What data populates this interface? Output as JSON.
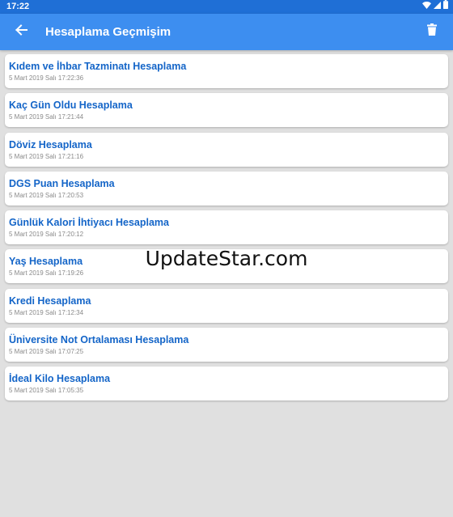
{
  "statusbar": {
    "time": "17:22",
    "icons": [
      "wifi-icon",
      "signal-icon",
      "battery-icon"
    ]
  },
  "appbar": {
    "title": "Hesaplama Geçmişim",
    "back_icon": "arrow-left-icon",
    "action_icon": "trash-icon"
  },
  "history": [
    {
      "title": "Kıdem ve İhbar Tazminatı Hesaplama",
      "date": "5 Mart 2019 Salı 17:22:36"
    },
    {
      "title": "Kaç Gün Oldu Hesaplama",
      "date": "5 Mart 2019 Salı 17:21:44"
    },
    {
      "title": "Döviz Hesaplama",
      "date": "5 Mart 2019 Salı 17:21:16"
    },
    {
      "title": "DGS Puan Hesaplama",
      "date": "5 Mart 2019 Salı 17:20:53"
    },
    {
      "title": "Günlük Kalori İhtiyacı Hesaplama",
      "date": "5 Mart 2019 Salı 17:20:12"
    },
    {
      "title": "Yaş Hesaplama",
      "date": "5 Mart 2019 Salı 17:19:26"
    },
    {
      "title": "Kredi Hesaplama",
      "date": "5 Mart 2019 Salı 17:12:34"
    },
    {
      "title": "Üniversite Not Ortalaması Hesaplama",
      "date": "5 Mart 2019 Salı 17:07:25"
    },
    {
      "title": "İdeal Kilo Hesaplama",
      "date": "5 Mart 2019 Salı 17:05:35"
    }
  ],
  "watermark": "UpdateStar.com",
  "colors": {
    "statusbar": "#1f6fd6",
    "appbar": "#3d8ef0",
    "item_title": "#1465c8",
    "background": "#e0e0e0"
  }
}
